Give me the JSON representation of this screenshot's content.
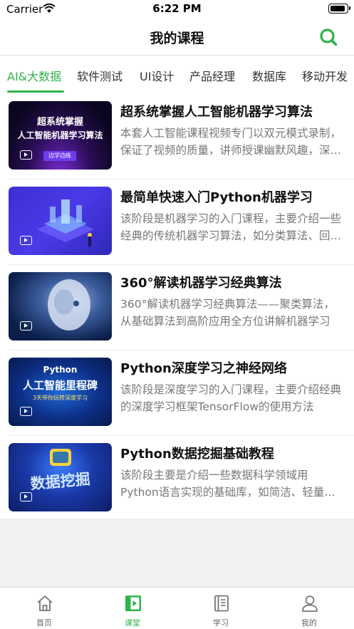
{
  "status_bar": {
    "carrier": "Carrier",
    "time": "6:22 PM",
    "battery_level": 0.95
  },
  "nav": {
    "title": "我的课程",
    "search_icon": "search-icon",
    "accent_color": "#2fb34a"
  },
  "tabs": [
    {
      "label": "AI&大数据",
      "active": true
    },
    {
      "label": "软件测试"
    },
    {
      "label": "UI设计"
    },
    {
      "label": "产品经理"
    },
    {
      "label": "数据库"
    },
    {
      "label": "移动开发"
    }
  ],
  "courses": [
    {
      "title": "超系统掌握人工智能机器学习算法",
      "desc": "本套人工智能课程视频专门以双元模式录制，保证了视频的质量，讲师授课幽默风趣，深入浅出",
      "thumb_line1": "超系统掌握",
      "thumb_line2": "人工智能机器学习算法",
      "thumb_tag": "边学边练"
    },
    {
      "title": "最简单快速入门Python机器学习",
      "desc": "该阶段是机器学习的入门课程，主要介绍一些经典的传统机器学习算法，如分类算法、回归算法"
    },
    {
      "title": "360°解读机器学习经典算法",
      "desc": "360°解读机器学习经典算法——聚类算法，从基础算法到高阶应用全方位讲解机器学习"
    },
    {
      "title": "Python深度学习之神经网络",
      "desc": "该阶段是深度学习的入门课程，主要介绍经典的深度学习框架TensorFlow的使用方法",
      "thumb_line1": "Python",
      "thumb_line2": "人工智能里程碑",
      "thumb_tag": "3天带你玩转深度学习"
    },
    {
      "title": "Python数据挖掘基础教程",
      "desc": "该阶段主要是介绍一些数据科学领域用Python语言实现的基础库，如简洁、轻量级的Matplotlib",
      "thumb_line1": "数据挖掘"
    }
  ],
  "tabbar": [
    {
      "label": "首页",
      "icon": "home-icon"
    },
    {
      "label": "课堂",
      "icon": "classroom-icon",
      "active": true
    },
    {
      "label": "学习",
      "icon": "book-icon"
    },
    {
      "label": "我的",
      "icon": "user-icon"
    }
  ]
}
